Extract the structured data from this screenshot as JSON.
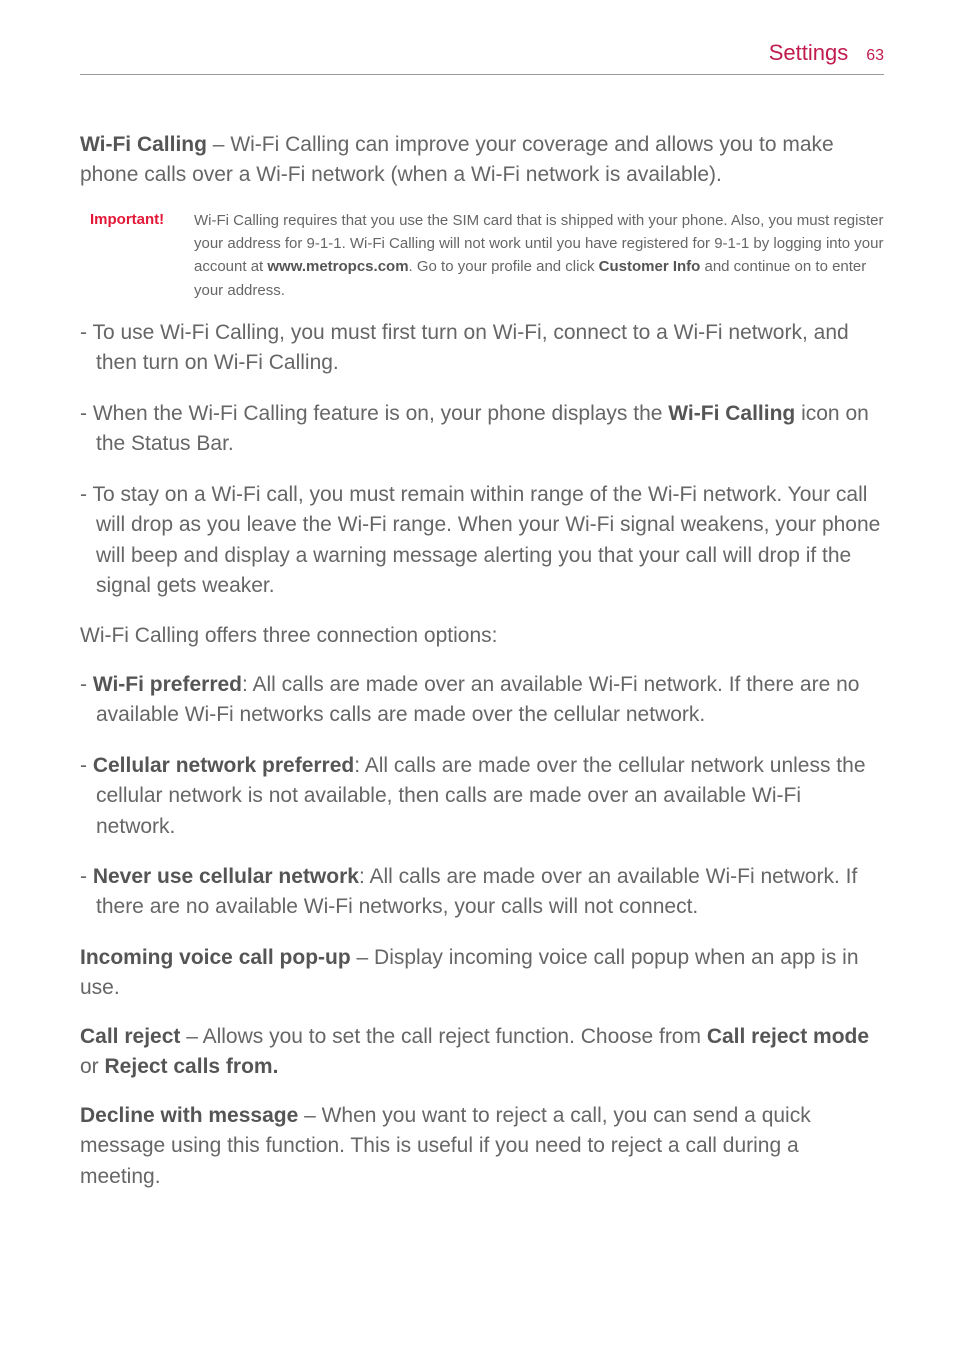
{
  "header": {
    "title": "Settings",
    "pageNumber": "63"
  },
  "content": {
    "wifiCalling": {
      "title": "Wi-Fi Calling",
      "desc": " – Wi-Fi Calling can improve your coverage and allows you to make phone calls over a Wi-Fi network (when a Wi-Fi network is available)."
    },
    "important": {
      "label": "Important!",
      "text1": "Wi-Fi Calling requires that you use the SIM card that is shipped with your phone. Also, you must register your address for 9-1-1. Wi-Fi Calling will not work until you have registered for 9-1-1 by logging into your account at ",
      "url": "www.metropcs.com",
      "text2": ". Go to your profile and click ",
      "bold": "Customer Info",
      "text3": " and continue on to enter your address."
    },
    "bullets": {
      "b1": "- To use Wi-Fi Calling, you must first turn on Wi-Fi, connect to a Wi-Fi network, and then turn on Wi-Fi Calling.",
      "b2a": "- When the Wi-Fi Calling feature is on, your phone displays the ",
      "b2bold": "Wi-Fi Calling",
      "b2b": " icon on the Status Bar.",
      "b3": "- To stay on a Wi-Fi call, you must remain within range of the Wi-Fi network. Your call will drop as you leave the Wi-Fi range. When your Wi-Fi signal weakens, your phone will beep and display a warning message alerting you that your call will drop if the signal gets weaker."
    },
    "optionsIntro": "Wi-Fi Calling offers three connection options:",
    "options": {
      "o1title": "Wi-Fi preferred",
      "o1text": ": All calls are made over an available Wi-Fi network. If there are no available Wi-Fi networks calls are made over the cellular network.",
      "o2title": "Cellular network preferred",
      "o2text": ": All calls are made over the cellular network unless the cellular network is not available, then calls are made over an available Wi-Fi network.",
      "o3title": "Never use cellular network",
      "o3text": ": All calls are made over an available Wi-Fi network. If there are no available Wi-Fi networks, your calls will not connect."
    },
    "incoming": {
      "title": "Incoming voice call pop-up",
      "text": " – Display incoming voice call popup when an app is in use."
    },
    "callReject": {
      "title": "Call reject",
      "text1": " – Allows you to set the call reject function. Choose from ",
      "bold1": "Call reject mode",
      "text2": " or ",
      "bold2": "Reject calls from."
    },
    "decline": {
      "title": "Decline with message",
      "text": " – When you want to reject a call, you can send a quick message using this function. This is useful if you need to reject a call during a meeting."
    }
  }
}
